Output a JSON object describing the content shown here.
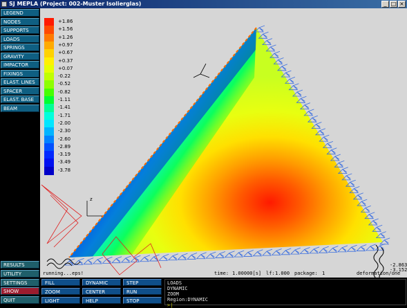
{
  "window": {
    "title": "SJ MEPLA (Project: 002-Muster Isolierglas)",
    "buttons": [
      "_",
      "□",
      "×"
    ]
  },
  "sidebar": {
    "top_items": [
      {
        "label": "LEGEND",
        "name": "legend"
      },
      {
        "label": "NODES",
        "name": "nodes"
      },
      {
        "label": "SUPPORTS",
        "name": "supports"
      },
      {
        "label": "LOADS",
        "name": "loads"
      },
      {
        "label": "SPRINGS",
        "name": "springs"
      },
      {
        "label": "GRAVITY",
        "name": "gravity"
      },
      {
        "label": "IMPACTOR",
        "name": "impactor"
      },
      {
        "label": "FIXINGS",
        "name": "fixings"
      },
      {
        "label": "ELAST. LINES",
        "name": "elast-lines"
      },
      {
        "label": "SPACER",
        "name": "spacer"
      },
      {
        "label": "ELAST. BASE",
        "name": "elast-base"
      },
      {
        "label": "BEAM",
        "name": "beam"
      }
    ],
    "bottom_items": [
      {
        "label": "RESULTS",
        "name": "results",
        "style": "teal"
      },
      {
        "label": "UTILITY",
        "name": "utility",
        "style": "teal"
      },
      {
        "label": "SETTINGS",
        "name": "settings",
        "style": "teal"
      },
      {
        "label": "SHOW",
        "name": "show",
        "style": "red"
      },
      {
        "label": "QUIT",
        "name": "quit",
        "style": "teal"
      }
    ]
  },
  "legend": {
    "entries": [
      {
        "value": "+1.86",
        "color": "#ff1a00"
      },
      {
        "value": "+1.56",
        "color": "#ff4a00"
      },
      {
        "value": "+1.26",
        "color": "#ff7a00"
      },
      {
        "value": "+0.97",
        "color": "#ffaa00"
      },
      {
        "value": "+0.67",
        "color": "#ffd200"
      },
      {
        "value": "+0.37",
        "color": "#fff000"
      },
      {
        "value": "+0.07",
        "color": "#e6ff00"
      },
      {
        "value": "-0.22",
        "color": "#c0ff00"
      },
      {
        "value": "-0.52",
        "color": "#8cff00"
      },
      {
        "value": "-0.82",
        "color": "#46ff00"
      },
      {
        "value": "-1.11",
        "color": "#00ff32"
      },
      {
        "value": "-1.41",
        "color": "#00ff96"
      },
      {
        "value": "-1.71",
        "color": "#00ffdc"
      },
      {
        "value": "-2.00",
        "color": "#00e6ff"
      },
      {
        "value": "-2.30",
        "color": "#00b4ff"
      },
      {
        "value": "-2.60",
        "color": "#0082ff"
      },
      {
        "value": "-2.89",
        "color": "#0050ff"
      },
      {
        "value": "-3.19",
        "color": "#0028ff"
      },
      {
        "value": "-3.49",
        "color": "#0010f0"
      },
      {
        "value": "-3.78",
        "color": "#0000c8"
      }
    ]
  },
  "viewport": {
    "axis_label": "z",
    "running_text": "running...eps!",
    "time_label": "time:",
    "time_value": "1.00000[s]",
    "lf_label": "lf:",
    "lf_value": "1.000",
    "package_label": "package:",
    "package_value": "1",
    "deformation_text": "deformation/one",
    "readout_1": "-2.863",
    "readout_2": "-3.152"
  },
  "bottom_buttons": {
    "col1": [
      "FILL",
      "ZOOM",
      "LIGHT"
    ],
    "col2": [
      "DYNAMIC",
      "CENTER",
      "HELP"
    ],
    "col3": [
      "STEP",
      "RUN",
      "STOP"
    ]
  },
  "console": {
    "lines": [
      "LOADS",
      "DYNAMIC",
      "ZOOM",
      "Region:DYNAMIC"
    ],
    "prompt": ">|"
  }
}
